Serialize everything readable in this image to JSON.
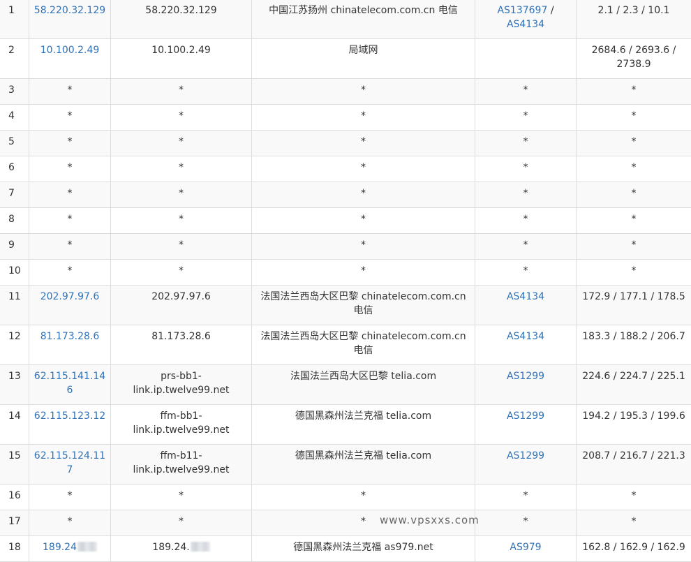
{
  "rows": [
    {
      "hop": "1",
      "ip": "58.220.32.129",
      "host": "58.220.32.129",
      "geo": "中国江苏扬州 chinatelecom.com.cn 电信",
      "asn": [
        "AS137697",
        "AS4134"
      ],
      "latency": "2.1 / 2.3 / 10.1"
    },
    {
      "hop": "2",
      "ip": "10.100.2.49",
      "host": "10.100.2.49",
      "geo": "局域网",
      "asn": [],
      "latency": "2684.6 / 2693.6 / 2738.9"
    },
    {
      "hop": "3",
      "ip": "*",
      "host": "*",
      "geo": "*",
      "asn": [
        "*"
      ],
      "latency": "*",
      "empty": true
    },
    {
      "hop": "4",
      "ip": "*",
      "host": "*",
      "geo": "*",
      "asn": [
        "*"
      ],
      "latency": "*",
      "empty": true
    },
    {
      "hop": "5",
      "ip": "*",
      "host": "*",
      "geo": "*",
      "asn": [
        "*"
      ],
      "latency": "*",
      "empty": true
    },
    {
      "hop": "6",
      "ip": "*",
      "host": "*",
      "geo": "*",
      "asn": [
        "*"
      ],
      "latency": "*",
      "empty": true
    },
    {
      "hop": "7",
      "ip": "*",
      "host": "*",
      "geo": "*",
      "asn": [
        "*"
      ],
      "latency": "*",
      "empty": true
    },
    {
      "hop": "8",
      "ip": "*",
      "host": "*",
      "geo": "*",
      "asn": [
        "*"
      ],
      "latency": "*",
      "empty": true
    },
    {
      "hop": "9",
      "ip": "*",
      "host": "*",
      "geo": "*",
      "asn": [
        "*"
      ],
      "latency": "*",
      "empty": true
    },
    {
      "hop": "10",
      "ip": "*",
      "host": "*",
      "geo": "*",
      "asn": [
        "*"
      ],
      "latency": "*",
      "empty": true
    },
    {
      "hop": "11",
      "ip": "202.97.97.6",
      "host": "202.97.97.6",
      "geo": "法国法兰西岛大区巴黎 chinatelecom.com.cn 电信",
      "asn": [
        "AS4134"
      ],
      "latency": "172.9 / 177.1 / 178.5"
    },
    {
      "hop": "12",
      "ip": "81.173.28.6",
      "host": "81.173.28.6",
      "geo": "法国法兰西岛大区巴黎 chinatelecom.com.cn 电信",
      "asn": [
        "AS4134"
      ],
      "latency": "183.3 / 188.2 / 206.7"
    },
    {
      "hop": "13",
      "ip": "62.115.141.146",
      "host": "prs-bb1-link.ip.twelve99.net",
      "geo": "法国法兰西岛大区巴黎 telia.com",
      "asn": [
        "AS1299"
      ],
      "latency": "224.6 / 224.7 / 225.1"
    },
    {
      "hop": "14",
      "ip": "62.115.123.12",
      "host": "ffm-bb1-link.ip.twelve99.net",
      "geo": "德国黑森州法兰克福 telia.com",
      "asn": [
        "AS1299"
      ],
      "latency": "194.2 / 195.3 / 199.6"
    },
    {
      "hop": "15",
      "ip": "62.115.124.117",
      "host": "ffm-b11-link.ip.twelve99.net",
      "geo": "德国黑森州法兰克福 telia.com",
      "asn": [
        "AS1299"
      ],
      "latency": "208.7 / 216.7 / 221.3"
    },
    {
      "hop": "16",
      "ip": "*",
      "host": "*",
      "geo": "*",
      "asn": [
        "*"
      ],
      "latency": "*",
      "empty": true
    },
    {
      "hop": "17",
      "ip": "*",
      "host": "*",
      "geo": "*",
      "asn": [
        "*"
      ],
      "latency": "*",
      "empty": true
    },
    {
      "hop": "18",
      "ip": "189.24",
      "host": "189.24.",
      "geo": "德国黑森州法兰克福 as979.net",
      "asn": [
        "AS979"
      ],
      "latency": "162.8 / 162.9 / 162.9",
      "masked": true
    }
  ],
  "watermark": "www.vpsxxs.com",
  "colors": {
    "link": "#2f72b8",
    "text": "#333333",
    "border": "#dddddd",
    "stripe": "#f9f9f9"
  }
}
